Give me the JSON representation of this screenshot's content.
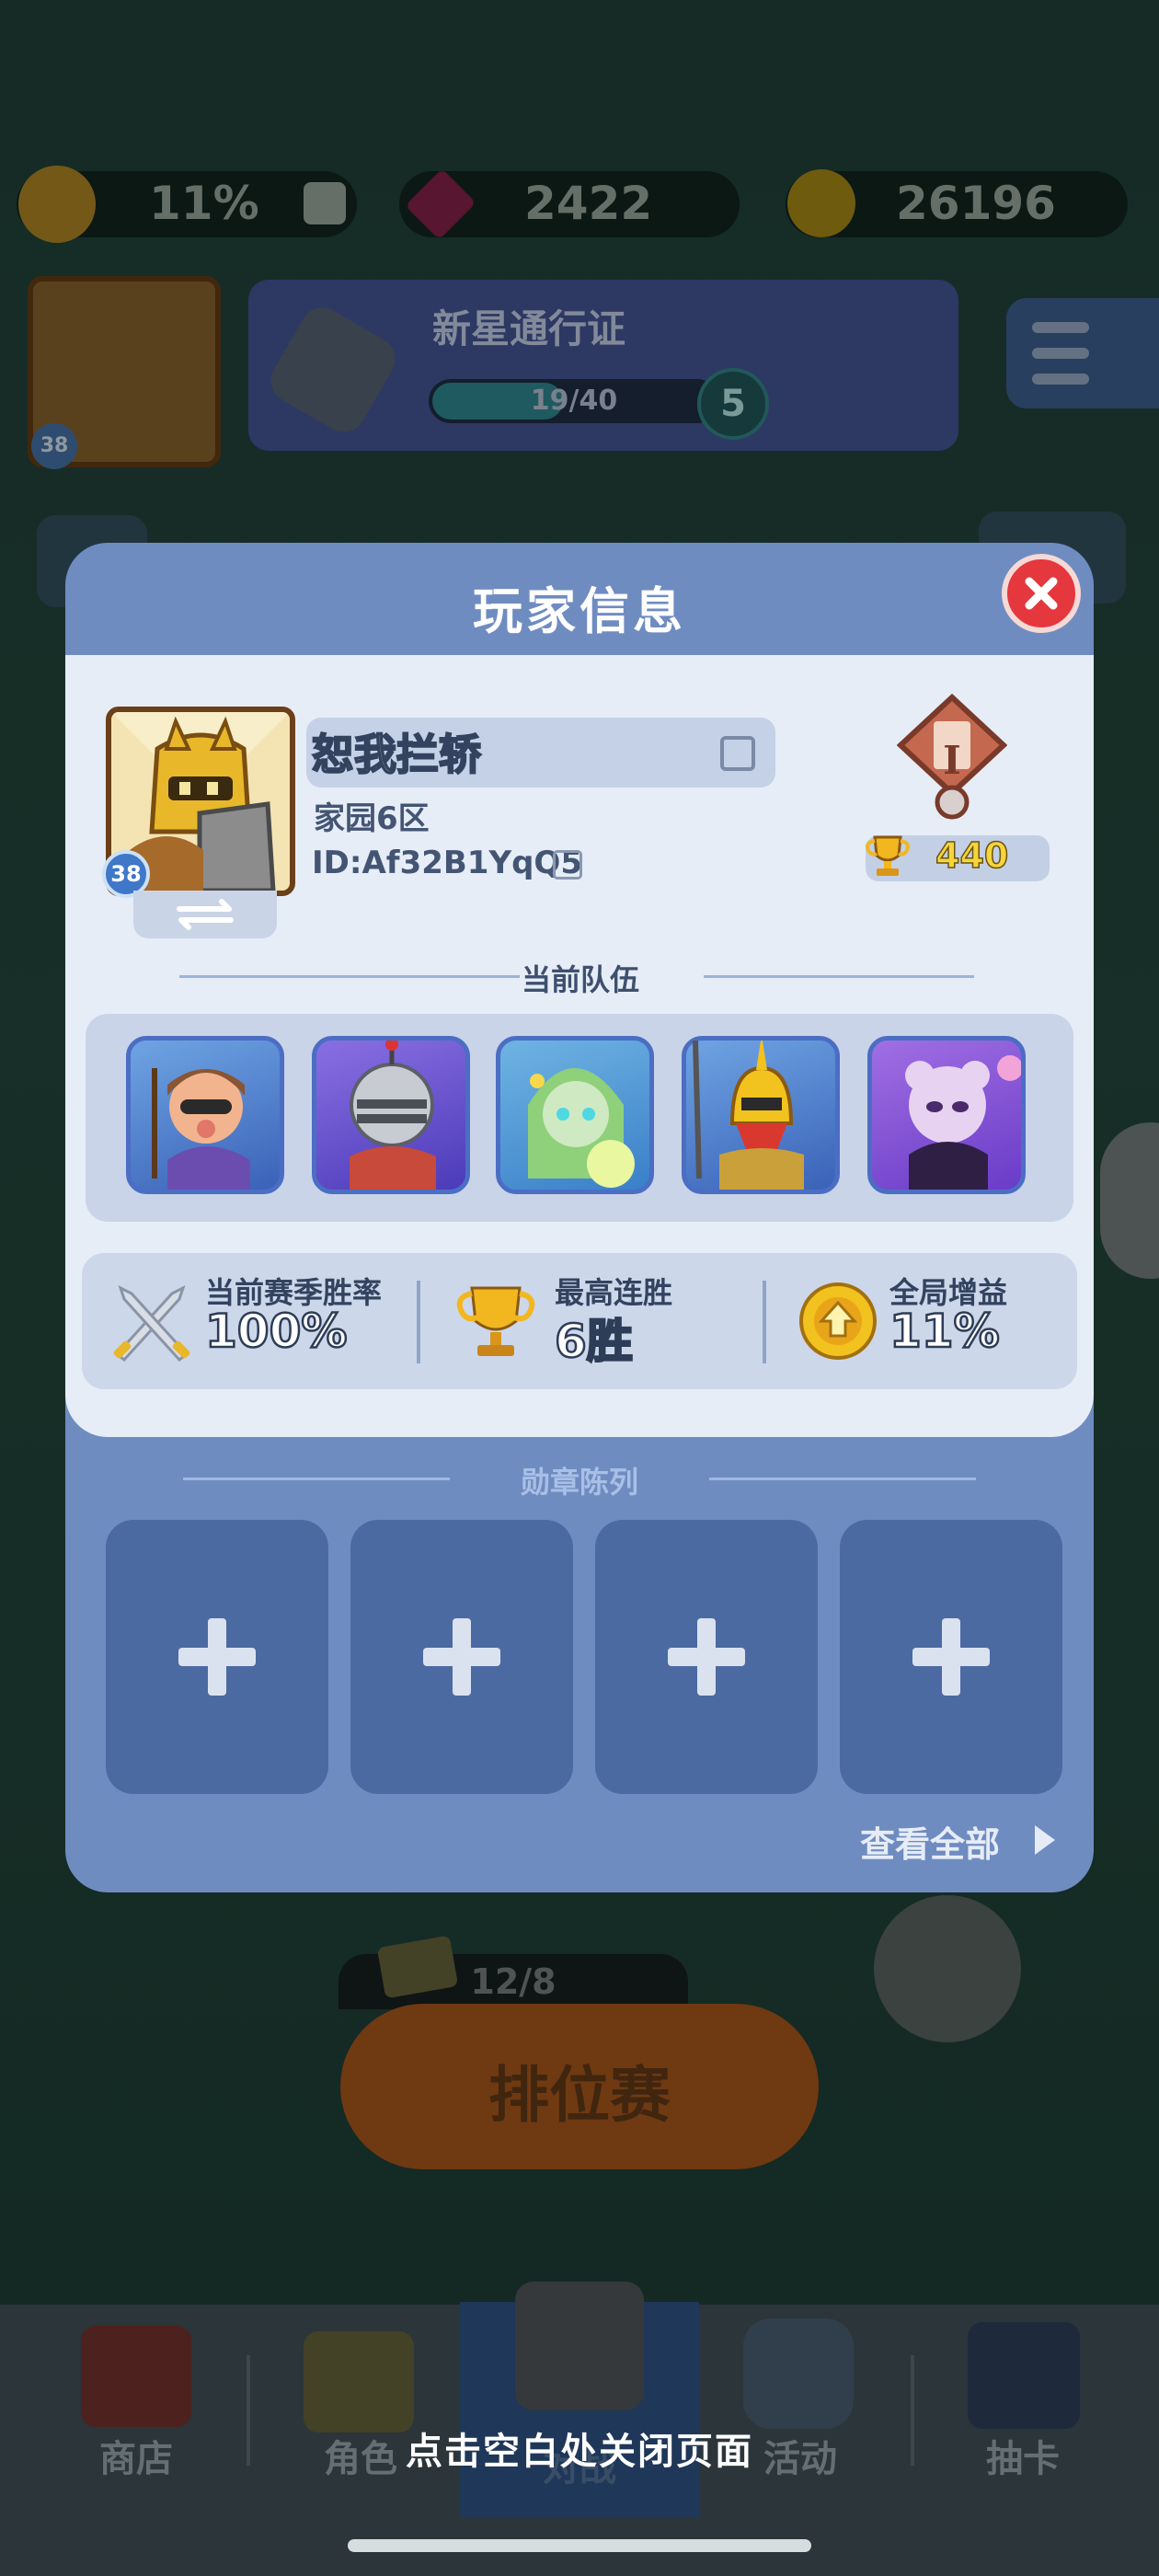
{
  "top_bar": {
    "global_buff": "11%",
    "gems": "2422",
    "coins": "26196"
  },
  "battle_pass": {
    "title": "新星通行证",
    "progress": "19/40",
    "progress_fraction": 0.475,
    "level": "5"
  },
  "header_avatar_level": "38",
  "ranked": {
    "tickets": "12/8",
    "button_label": "排位赛"
  },
  "bottom_nav": {
    "items": [
      "商店",
      "角色",
      "对战",
      "活动",
      "抽卡"
    ]
  },
  "dialog": {
    "title": "玩家信息",
    "player": {
      "name": "恕我拦轿",
      "server": "家园6区",
      "id": "ID:Af32B1YqQ5",
      "level": "38",
      "rank_numeral": "I",
      "trophies": "440"
    },
    "team_section_title": "当前队伍",
    "team": [
      {
        "name": "hero-archer"
      },
      {
        "name": "hero-knight"
      },
      {
        "name": "hero-dryad"
      },
      {
        "name": "hero-golden-warrior"
      },
      {
        "name": "hero-shadow-mage"
      }
    ],
    "stats": [
      {
        "label": "当前赛季胜率",
        "value": "100%",
        "icon": "crossed-swords-icon"
      },
      {
        "label": "最高连胜",
        "value": "6胜",
        "icon": "trophy-icon"
      },
      {
        "label": "全局增益",
        "value": "11%",
        "icon": "buff-crest-icon"
      }
    ],
    "medal_section_title": "勋章陈列",
    "medal_slots": 4,
    "view_all": "查看全部"
  },
  "close_hint": "点击空白处关闭页面",
  "colors": {
    "dialog_frame": "#6f8cc1",
    "dialog_inner": "#e6edf7",
    "close_button": "#e5373e",
    "medal_slot": "#4c6aa2",
    "trophy_text": "#f5d53b"
  }
}
